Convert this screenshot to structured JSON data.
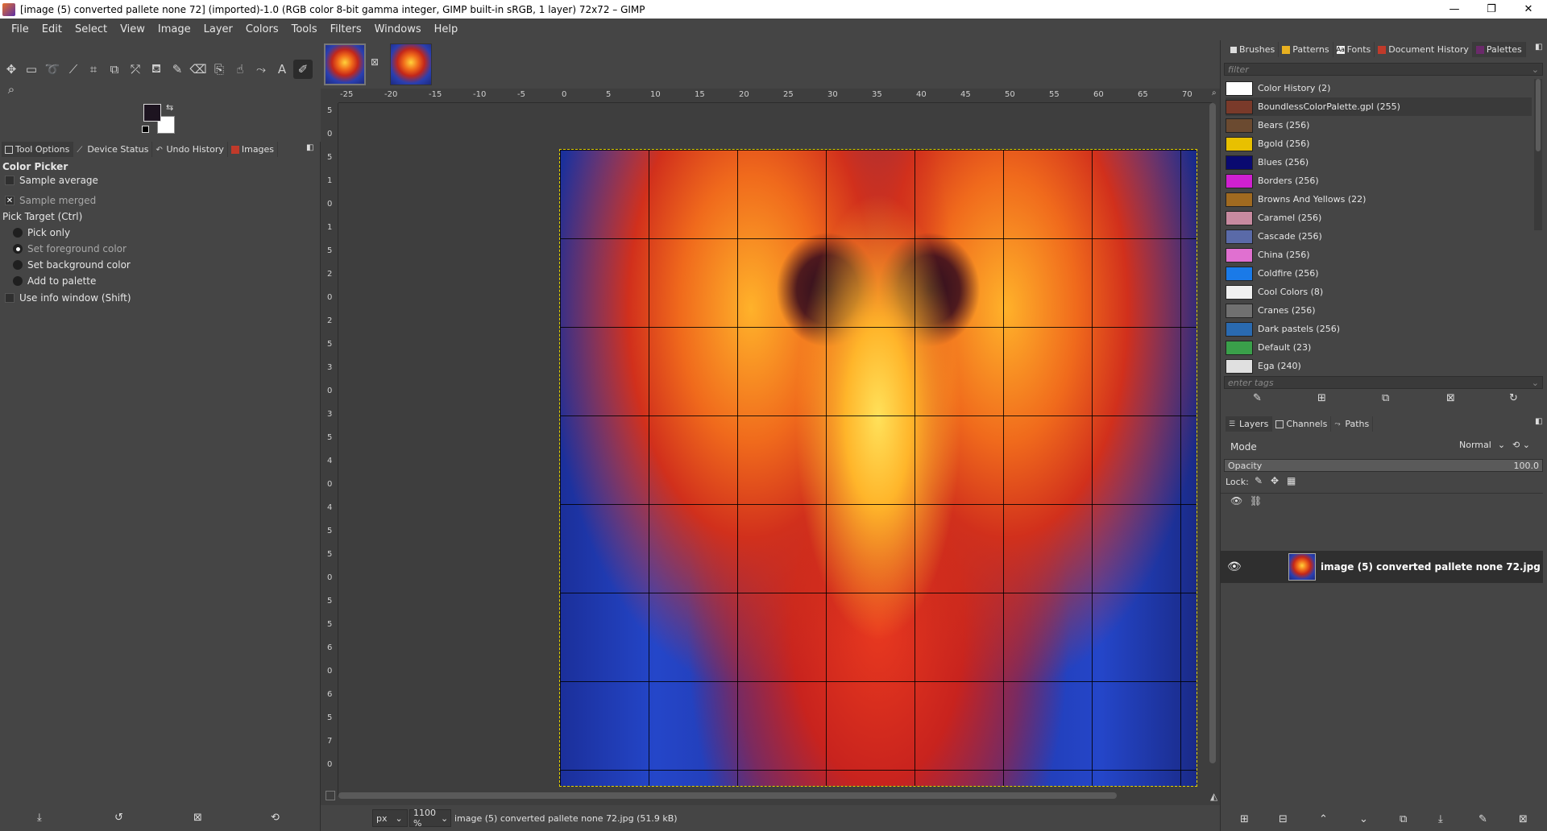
{
  "window": {
    "title": "[image (5) converted pallete none 72] (imported)-1.0 (RGB color 8-bit gamma integer, GIMP built-in sRGB, 1 layer) 72x72 – GIMP",
    "minimize": "—",
    "maximize": "❐",
    "close": "✕"
  },
  "menu": [
    "File",
    "Edit",
    "Select",
    "View",
    "Image",
    "Layer",
    "Colors",
    "Tools",
    "Filters",
    "Windows",
    "Help"
  ],
  "tools": [
    "move-icon",
    "rect-select-icon",
    "free-select-icon",
    "fuzzy-select-icon",
    "crop-icon",
    "unified-transform-icon",
    "warp-icon",
    "bucket-fill-icon",
    "paintbrush-icon",
    "eraser-icon",
    "clone-icon",
    "smudge-icon",
    "paths-icon",
    "text-icon",
    "color-picker-icon",
    "zoom-icon"
  ],
  "colors": {
    "foreground": "#1d1420",
    "background": "#ffffff",
    "accent_selection": "#e6d400"
  },
  "left_tabs": [
    "Tool Options",
    "Device Status",
    "Undo History",
    "Images"
  ],
  "tool_options": {
    "title": "Color Picker",
    "sample_average": "Sample average",
    "sample_merged": "Sample merged",
    "pick_target": "Pick Target  (Ctrl)",
    "pick_only": "Pick only",
    "set_foreground": "Set foreground color",
    "set_background": "Set background color",
    "add_to_palette": "Add to palette",
    "use_info_window": "Use info window  (Shift)"
  },
  "ruler_h": [
    "-25",
    "-20",
    "-15",
    "-10",
    "-5",
    "0",
    "5",
    "10",
    "15",
    "20",
    "25",
    "30",
    "35",
    "40",
    "45",
    "50",
    "55",
    "60",
    "65",
    "70"
  ],
  "ruler_v": [
    "5",
    "0",
    "5",
    "1",
    "0",
    "1",
    "5",
    "2",
    "0",
    "2",
    "5",
    "3",
    "0",
    "3",
    "5",
    "4",
    "0",
    "4",
    "5",
    "5",
    "0",
    "5",
    "5",
    "6",
    "0",
    "6",
    "5",
    "7",
    "0"
  ],
  "status": {
    "unit": "px",
    "zoom": "1100 %",
    "message": "image (5) converted pallete none 72.jpg (51.9 kB)"
  },
  "right_tabs": [
    "Brushes",
    "Patterns",
    "Fonts",
    "Document History",
    "Palettes"
  ],
  "palettes": {
    "filter_placeholder": "filter",
    "tags_placeholder": "enter tags",
    "items": [
      {
        "label": "Color History (2)",
        "swatch": "#ffffff"
      },
      {
        "label": "BoundlessColorPalette.gpl (255)",
        "swatch": "#7a3a2a"
      },
      {
        "label": "Bears (256)",
        "swatch": "#6b4a30"
      },
      {
        "label": "Bgold (256)",
        "swatch": "#e8c000"
      },
      {
        "label": "Blues (256)",
        "swatch": "#0a0a70"
      },
      {
        "label": "Borders (256)",
        "swatch": "#d020d0"
      },
      {
        "label": "Browns And Yellows (22)",
        "swatch": "#a06a20"
      },
      {
        "label": "Caramel (256)",
        "swatch": "#c88aa0"
      },
      {
        "label": "Cascade (256)",
        "swatch": "#5a6aa8"
      },
      {
        "label": "China (256)",
        "swatch": "#e070d0"
      },
      {
        "label": "Coldfire (256)",
        "swatch": "#1a7ae8"
      },
      {
        "label": "Cool Colors (8)",
        "swatch": "#f0f0f0"
      },
      {
        "label": "Cranes (256)",
        "swatch": "#707070"
      },
      {
        "label": "Dark pastels (256)",
        "swatch": "#2a6ab0"
      },
      {
        "label": "Default (23)",
        "swatch": "#3aa04a"
      },
      {
        "label": "Ega (240)",
        "swatch": "#e0e0e0"
      }
    ]
  },
  "layers_tabs": [
    "Layers",
    "Channels",
    "Paths"
  ],
  "layers": {
    "mode_label": "Mode",
    "mode_value": "Normal",
    "opacity_label": "Opacity",
    "opacity_value": "100.0",
    "lock_label": "Lock:",
    "items": [
      {
        "name": "image (5) converted pallete none 72.jpg"
      }
    ]
  }
}
